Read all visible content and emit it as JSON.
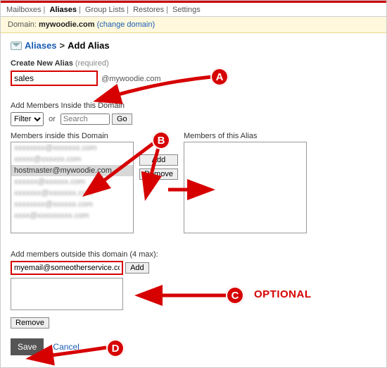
{
  "tabs": {
    "mailboxes": "Mailboxes",
    "aliases": "Aliases",
    "grouplists": "Group Lists",
    "restores": "Restores",
    "settings": "Settings"
  },
  "domainbar": {
    "label": "Domain:",
    "domain": "mywoodie.com",
    "change": "(change domain)"
  },
  "crumb": {
    "aliases": "Aliases",
    "arrow": ">",
    "add": "Add Alias"
  },
  "create": {
    "title": "Create New Alias",
    "req": "(required)",
    "value": "sales",
    "at": "@mywoodie.com"
  },
  "members": {
    "title": "Add Members Inside this Domain",
    "filter_sel": "Filter",
    "or": "or",
    "search_ph": "Search",
    "go": "Go",
    "left_label": "Members inside this Domain",
    "right_label": "Members of this Alias",
    "add": "Add",
    "remove": "Remove",
    "domain_list": [
      "xxxxxxxx@xxxxxxx.com",
      "xxxxx@xxxxxx.com",
      "hostmaster@mywoodie.com",
      "xxxxxx@xxxxxx.com",
      "xxxxxxx@xxxxxxx.com",
      "xxxxxxxx@xxxxxx.com",
      "xxxx@xxxxxxxxx.com"
    ],
    "selected_index": 2
  },
  "outside": {
    "title": "Add members outside this domain (4 max):",
    "value": "myemail@someotherservice.com",
    "add": "Add",
    "remove": "Remove"
  },
  "actions": {
    "save": "Save",
    "cancel": "Cancel"
  },
  "anno": {
    "A": "A",
    "B": "B",
    "C": "C",
    "D": "D",
    "optional": "OPTIONAL"
  }
}
